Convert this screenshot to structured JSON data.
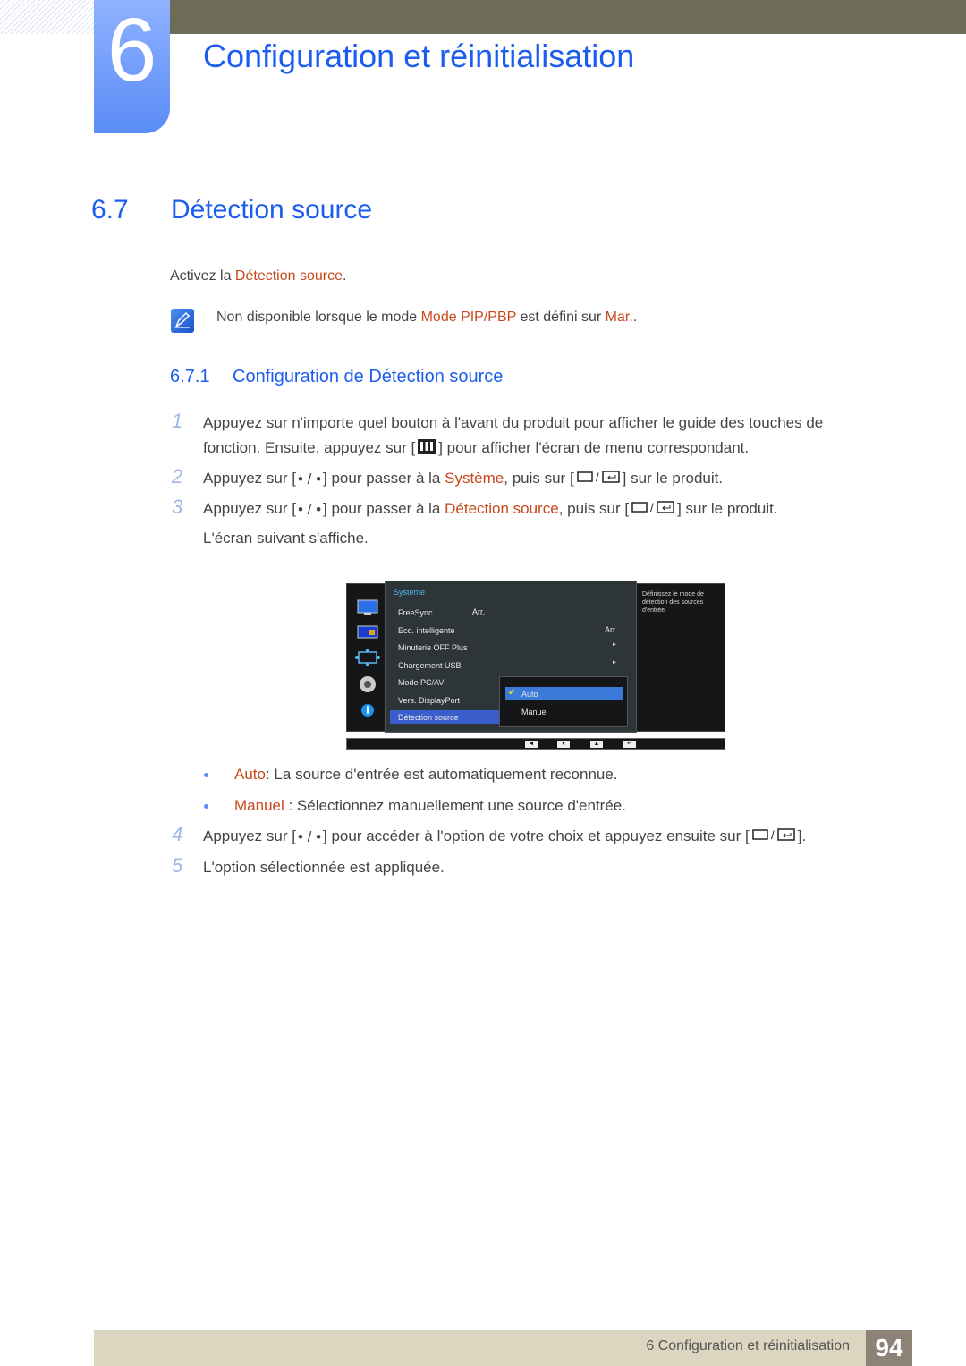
{
  "chapter": {
    "number": "6",
    "title": "Configuration et réinitialisation"
  },
  "section": {
    "number": "6.7",
    "title": "Détection source"
  },
  "intro": {
    "prefix": "Activez la ",
    "highlight": "Détection source",
    "suffix": "."
  },
  "note": {
    "text1": "Non disponible lorsque le mode ",
    "hl1": "Mode PIP/PBP",
    "text2": " est défini sur ",
    "hl2": "Mar.",
    "text3": "."
  },
  "subsection": {
    "number": "6.7.1",
    "title": "Configuration de Détection source"
  },
  "steps": [
    {
      "num": "1",
      "line1": "Appuyez sur n'importe quel bouton à l'avant du produit pour afficher le guide des touches de",
      "line2a": "fonction. Ensuite, appuyez sur [",
      "line2b": "] pour afficher l'écran de menu correspondant."
    },
    {
      "num": "2",
      "a": "Appuyez sur [",
      "b": "] pour passer à la ",
      "hl": "Système",
      "c": ", puis sur [",
      "d": "] sur le produit."
    },
    {
      "num": "3",
      "a": "Appuyez sur [",
      "b": "] pour passer à la ",
      "hl": "Détection source",
      "c": ", puis sur [",
      "d": "] sur le produit.",
      "line2": "L'écran suivant s'affiche."
    },
    {
      "num": "4",
      "a": "Appuyez sur [",
      "b": "] pour accéder à l'option de votre choix et appuyez ensuite sur [",
      "c": "]."
    },
    {
      "num": "5",
      "text": "L'option sélectionnée est appliquée."
    }
  ],
  "options": [
    {
      "label": "Auto",
      "desc": ": La source d'entrée est automatiquement reconnue."
    },
    {
      "label": "Manuel",
      "desc": " : Sélectionnez manuellement une source d'entrée."
    }
  ],
  "osd": {
    "menu_title": "Système",
    "items": [
      {
        "label": "FreeSync",
        "value": "Arr."
      },
      {
        "label": "Eco. intelligente",
        "value": "Arr."
      },
      {
        "label": "Minuterie OFF Plus",
        "value": "►"
      },
      {
        "label": "Chargement USB",
        "value": "►"
      },
      {
        "label": "Mode PC/AV",
        "value": ""
      },
      {
        "label": "Vers. DisplayPort",
        "value": ""
      },
      {
        "label": "Détection source",
        "value": ""
      }
    ],
    "submenu": [
      {
        "label": "Auto",
        "selected": true
      },
      {
        "label": "Manuel",
        "selected": false
      }
    ],
    "help": "Définissez le mode de détection des sources d'entrée.",
    "buttons": [
      "◄",
      "▼",
      "▲",
      "↵"
    ]
  },
  "footer": {
    "text": "6 Configuration et réinitialisation",
    "page": "94"
  }
}
